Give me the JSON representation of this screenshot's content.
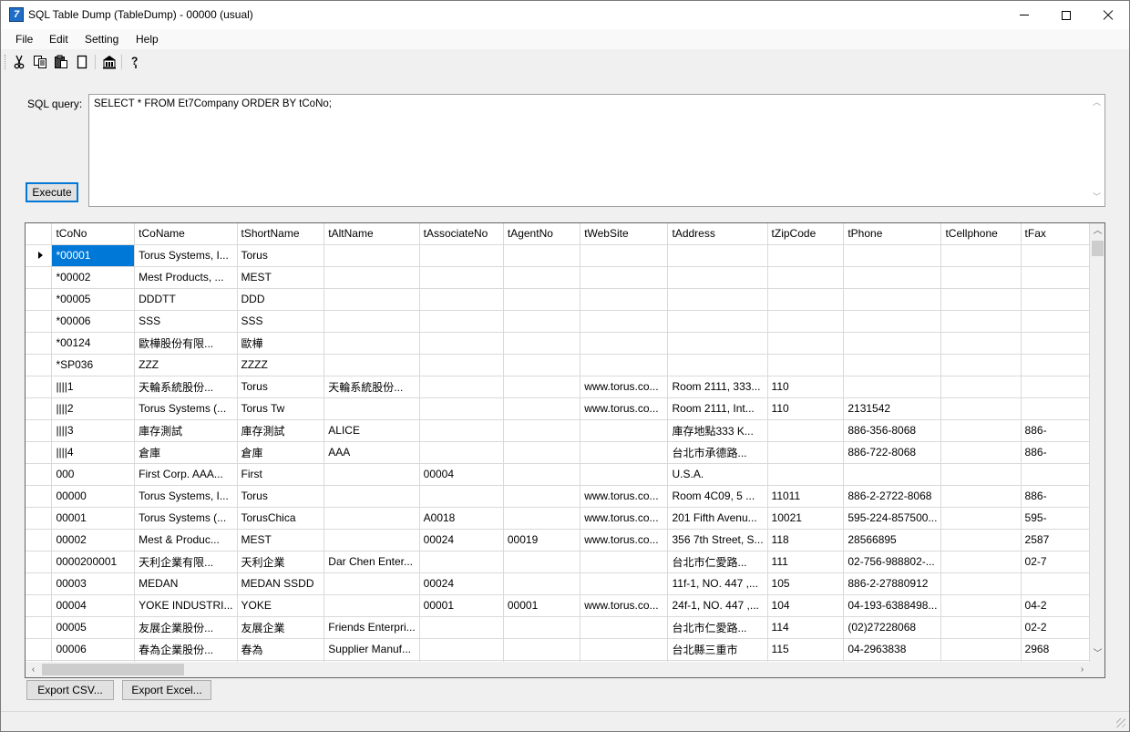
{
  "window": {
    "title": "SQL Table Dump (TableDump) - 00000 (usual)",
    "icon_letter": "7"
  },
  "menu": [
    "File",
    "Edit",
    "Setting",
    "Help"
  ],
  "toolbar": [
    "cut-icon",
    "copy-icon",
    "paste-icon",
    "new-icon",
    "home-icon",
    "help-icon"
  ],
  "query": {
    "label": "SQL query:",
    "text": "SELECT * FROM Et7Company ORDER BY tCoNo;",
    "execute_label": "Execute"
  },
  "grid": {
    "columns": [
      "tCoNo",
      "tCoName",
      "tShortName",
      "tAltName",
      "tAssociateNo",
      "tAgentNo",
      "tWebSite",
      "tAddress",
      "tZipCode",
      "tPhone",
      "tCellphone",
      "tFax"
    ],
    "rows": [
      [
        "*00001",
        "Torus Systems, I...",
        "Torus",
        "",
        "",
        "",
        "",
        "",
        "",
        "",
        "",
        ""
      ],
      [
        "*00002",
        "Mest Products, ...",
        "MEST",
        "",
        "",
        "",
        "",
        "",
        "",
        "",
        "",
        ""
      ],
      [
        "*00005",
        "DDDTT",
        "DDD",
        "",
        "",
        "",
        "",
        "",
        "",
        "",
        "",
        ""
      ],
      [
        "*00006",
        "SSS",
        "SSS",
        "",
        "",
        "",
        "",
        "",
        "",
        "",
        "",
        ""
      ],
      [
        "*00124",
        "歐樺股份有限...",
        "歐樺",
        "",
        "",
        "",
        "",
        "",
        "",
        "",
        "",
        ""
      ],
      [
        "*SP036",
        "ZZZ",
        "ZZZZ",
        "",
        "",
        "",
        "",
        "",
        "",
        "",
        "",
        ""
      ],
      [
        "||||1",
        "天輪系統股份...",
        "Torus",
        "天輪系統股份...",
        "",
        "",
        "www.torus.co...",
        "Room 2111, 333...",
        "110",
        "",
        "",
        ""
      ],
      [
        "||||2",
        "Torus Systems (...",
        "Torus Tw",
        "",
        "",
        "",
        "www.torus.co...",
        "Room 2111, Int...",
        "110",
        "2131542",
        "",
        ""
      ],
      [
        "||||3",
        "庫存測試",
        "庫存測試",
        "ALICE",
        "",
        "",
        "",
        "庫存地點333 K...",
        "",
        "886-356-8068",
        "",
        "886-"
      ],
      [
        "||||4",
        "倉庫",
        "倉庫",
        "AAA",
        "",
        "",
        "",
        "台北市承德路...",
        "",
        "886-722-8068",
        "",
        "886-"
      ],
      [
        "000",
        "First Corp. AAA...",
        "First",
        "",
        "00004",
        "",
        "",
        "U.S.A.",
        "",
        "",
        "",
        ""
      ],
      [
        "00000",
        "Torus Systems, I...",
        "Torus",
        "",
        "",
        "",
        "www.torus.co...",
        "Room 4C09, 5 ...",
        "11011",
        "886-2-2722-8068",
        "",
        "886-"
      ],
      [
        "00001",
        "Torus Systems (...",
        "TorusChica",
        "",
        "A0018",
        "",
        "www.torus.co...",
        "201 Fifth Avenu...",
        "10021",
        "595-224-857500...",
        "",
        "595-"
      ],
      [
        "00002",
        "Mest & Produc...",
        "MEST",
        "",
        "00024",
        "00019",
        "www.torus.co...",
        "356 7th Street, S...",
        "118",
        "28566895",
        "",
        "2587"
      ],
      [
        "0000200001",
        "天利企業有限...",
        "天利企業",
        "Dar Chen Enter...",
        "",
        "",
        "",
        "台北市仁愛路...",
        "111",
        "02-756-988802-...",
        "",
        "02-7"
      ],
      [
        "00003",
        "MEDAN",
        "MEDAN SSDD",
        "",
        "00024",
        "",
        "",
        "11f-1, NO. 447 ,...",
        "105",
        "886-2-27880912",
        "",
        ""
      ],
      [
        "00004",
        "YOKE INDUSTRI...",
        "YOKE",
        "",
        "00001",
        "00001",
        "www.torus.co...",
        "24f-1, NO. 447 ,...",
        "104",
        "04-193-6388498...",
        "",
        "04-2"
      ],
      [
        "00005",
        "友展企業股份...",
        "友展企業",
        "Friends Enterpri...",
        "",
        "",
        "",
        "台北市仁愛路...",
        "114",
        "(02)27228068",
        "",
        "02-2"
      ],
      [
        "00006",
        "春為企業股份...",
        "春為",
        "Supplier Manuf...",
        "",
        "",
        "",
        "台北縣三重市",
        "115",
        "04-2963838",
        "",
        "2968"
      ],
      [
        "",
        "",
        "",
        "",
        "",
        "",
        "",
        "",
        "",
        "",
        "",
        ""
      ]
    ]
  },
  "buttons": {
    "export_csv": "Export CSV...",
    "export_excel": "Export Excel..."
  }
}
